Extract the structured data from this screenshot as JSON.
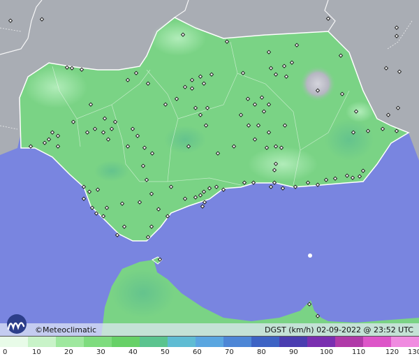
{
  "brand": "Meteoclimatic",
  "copyright_symbol": "©",
  "legend_title": "DGST (km/h)  02-09-2022 @ 23:52 UTC",
  "scale_ticks": [
    "0",
    "10",
    "20",
    "30",
    "40",
    "50",
    "60",
    "70",
    "80",
    "90",
    "100",
    "110",
    "120",
    "130"
  ],
  "scale_colors": [
    "#e8fbe8",
    "#c8f3c8",
    "#9ee89e",
    "#7edc7e",
    "#67d167",
    "#5bc48f",
    "#5fbcd3",
    "#5aa6e0",
    "#4d86d6",
    "#3d63c4",
    "#4a3db0",
    "#7a2fb0",
    "#b03aa8",
    "#dd55c8",
    "#f08be0"
  ],
  "colors": {
    "sea": "#7985e0",
    "land_outside": "#a9adb4",
    "andalusia": "#7ad385",
    "border": "#ffffff",
    "station": "#222222"
  },
  "icons": [
    "meteoclimatic-logo-icon",
    "station-marker-icon"
  ]
}
